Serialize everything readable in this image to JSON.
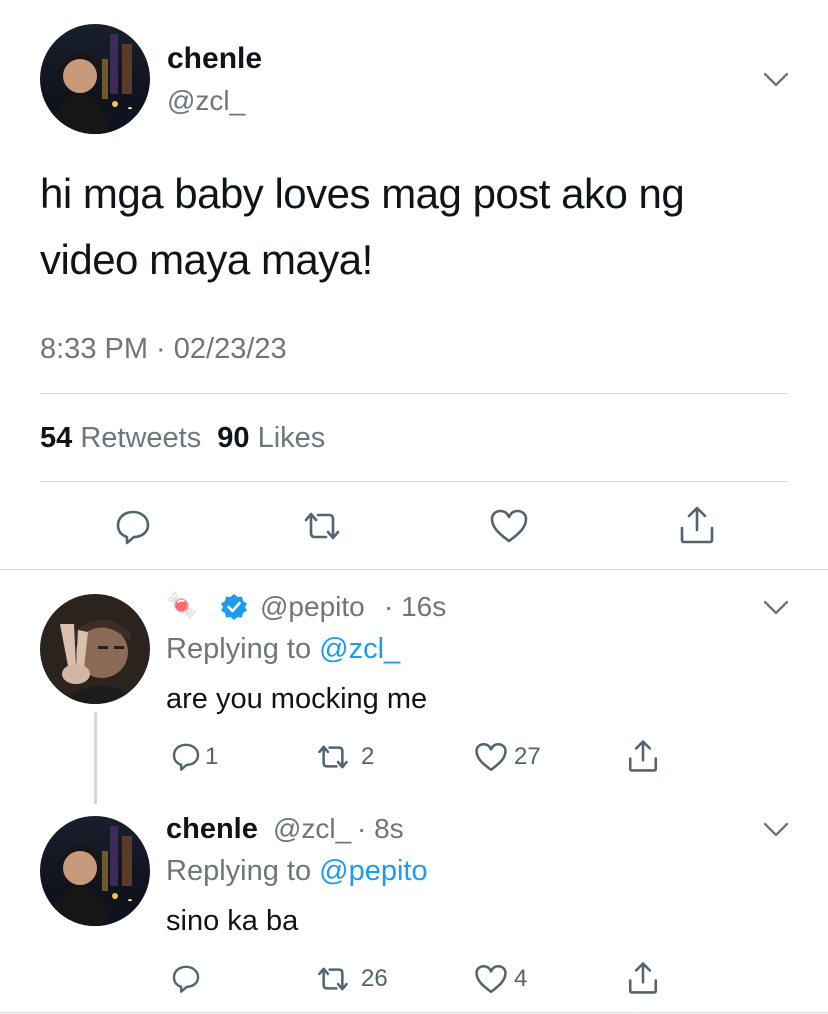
{
  "main_tweet": {
    "author_name": "chenle",
    "author_handle": "@zcl_",
    "text_line1": "hi mga baby loves mag post ako ng",
    "text_line2": "video maya maya!",
    "timestamp": "8:33 PM · 02/23/23",
    "retweets_count": "54",
    "retweets_label": "Retweets",
    "likes_count": "90",
    "likes_label": "Likes"
  },
  "reply1": {
    "emoji": "🍬",
    "handle": "@pepito",
    "time": "· 16s",
    "replying_prefix": "Replying to",
    "replying_to": "@zcl_",
    "text": "are you mocking me",
    "reply_count": "1",
    "retweet_count": "2",
    "like_count": "27"
  },
  "reply2": {
    "author_name": "chenle",
    "handle": "@zcl_",
    "time": "· 8s",
    "replying_prefix": "Replying to",
    "replying_to": "@pepito",
    "text": "sino ka ba",
    "retweet_count": "26",
    "like_count": "4"
  },
  "colors": {
    "accent": "#1d9bf0",
    "secondary_text": "#6e767d",
    "divider": "#cfd9de",
    "verified": "#1d9bf0"
  }
}
